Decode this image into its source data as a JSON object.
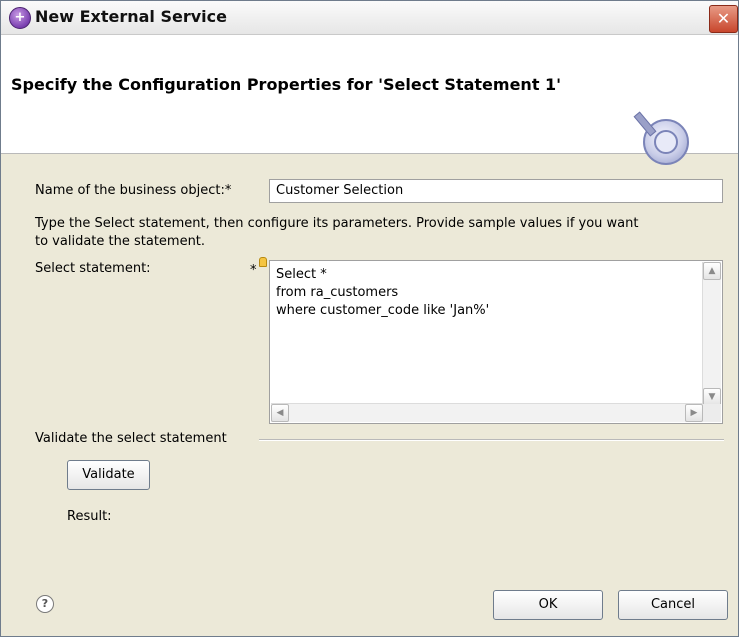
{
  "window": {
    "title": "New External Service",
    "close_glyph": "✕"
  },
  "banner": {
    "title": "Specify the Configuration Properties for 'Select Statement 1'",
    "icon": "wizard-banner-icon"
  },
  "form": {
    "bo_name_label": "Name of the business object:*",
    "bo_name_value": "Customer Selection",
    "instructions_line1": "Type the Select statement, then configure its parameters. Provide sample values if you want",
    "instructions_line2": "to validate the statement.",
    "select_label": "Select statement:",
    "required_marker": "*",
    "select_lines": [
      "Select *",
      "from ra_customers",
      "where customer_code like 'Jan%'"
    ]
  },
  "validate": {
    "section_label": "Validate the select statement",
    "button_label": "Validate",
    "result_label": "Result:"
  },
  "footer": {
    "help_glyph": "?",
    "ok_label": "OK",
    "cancel_label": "Cancel"
  },
  "scroll_glyphs": {
    "up": "▲",
    "down": "▼",
    "left": "◀",
    "right": "▶"
  }
}
